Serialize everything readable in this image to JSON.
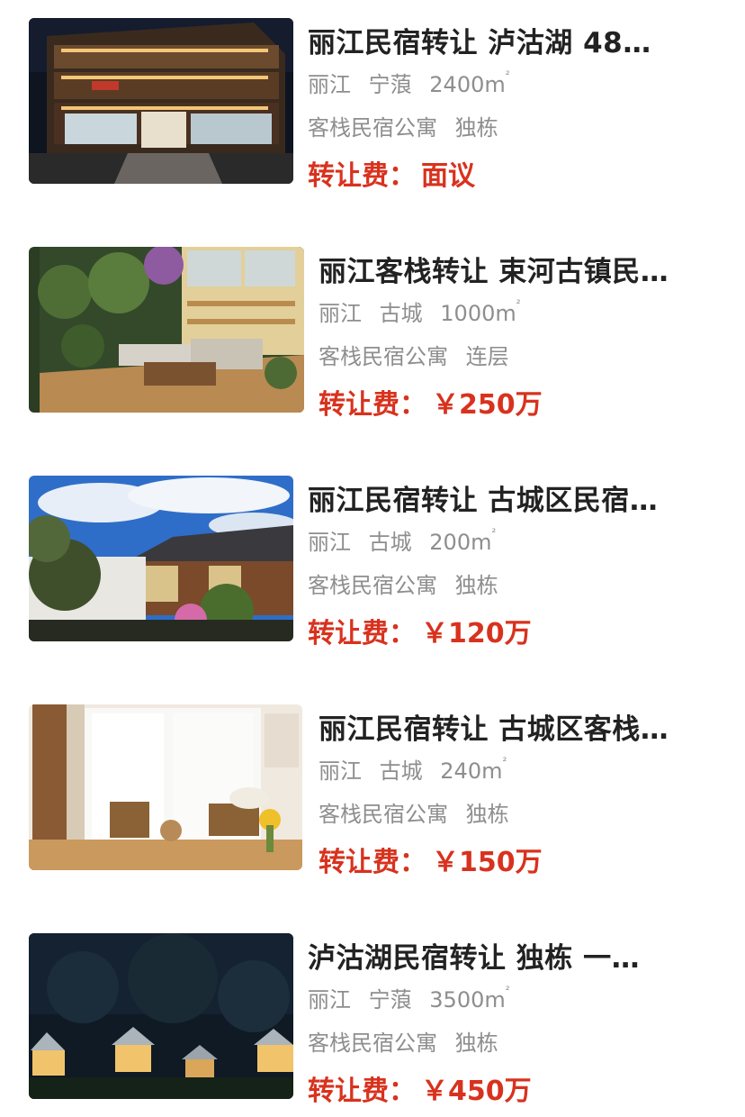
{
  "listings": [
    {
      "title": "丽江民宿转让 泸沽湖 48…",
      "city": "丽江",
      "district": "宁蒗",
      "area": "2400m",
      "area_sup": "²",
      "category": "客栈民宿公寓",
      "building": "独栋",
      "price_label": "转让费：",
      "price_value": "面议"
    },
    {
      "title": "丽江客栈转让 束河古镇民…",
      "city": "丽江",
      "district": "古城",
      "area": "1000m",
      "area_sup": "²",
      "category": "客栈民宿公寓",
      "building": "连层",
      "price_label": "转让费：",
      "price_value": "￥250万"
    },
    {
      "title": "丽江民宿转让 古城区民宿…",
      "city": "丽江",
      "district": "古城",
      "area": "200m",
      "area_sup": "²",
      "category": "客栈民宿公寓",
      "building": "独栋",
      "price_label": "转让费：",
      "price_value": "￥120万"
    },
    {
      "title": "丽江民宿转让 古城区客栈…",
      "city": "丽江",
      "district": "古城",
      "area": "240m",
      "area_sup": "²",
      "category": "客栈民宿公寓",
      "building": "独栋",
      "price_label": "转让费：",
      "price_value": "￥150万"
    },
    {
      "title": "泸沽湖民宿转让 独栋 一…",
      "city": "丽江",
      "district": "宁蒗",
      "area": "3500m",
      "area_sup": "²",
      "category": "客栈民宿公寓",
      "building": "独栋",
      "price_label": "转让费：",
      "price_value": "￥450万"
    }
  ],
  "colors": {
    "price": "#d8321e",
    "title": "#222222",
    "meta": "#8e8e8e"
  }
}
